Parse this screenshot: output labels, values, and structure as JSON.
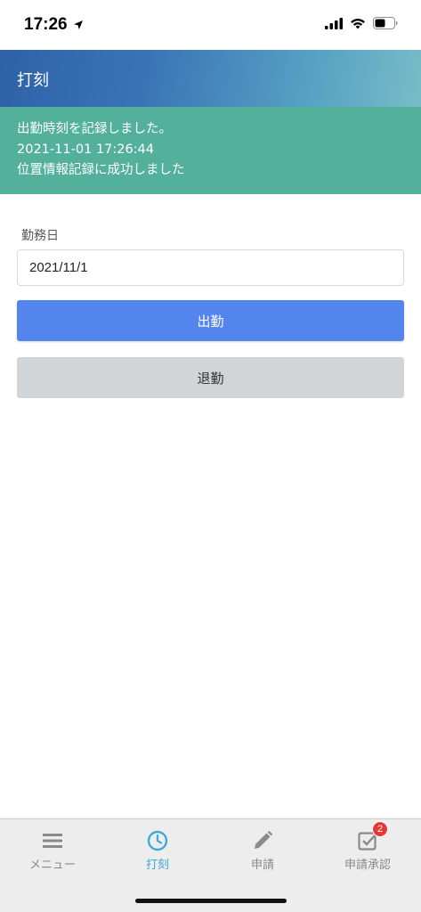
{
  "status_bar": {
    "time": "17:26"
  },
  "header": {
    "title": "打刻"
  },
  "notice": {
    "lines": [
      "出勤時刻を記録しました。",
      "2021-11-01 17:26:44",
      "位置情報記録に成功しました"
    ]
  },
  "form": {
    "work_date_label": "勤務日",
    "work_date_value": "2021/11/1",
    "clock_in_label": "出勤",
    "clock_out_label": "退勤"
  },
  "tab_bar": {
    "tabs": [
      {
        "label": "メニュー",
        "icon": "menu-icon",
        "active": false
      },
      {
        "label": "打刻",
        "icon": "clock-icon",
        "active": true
      },
      {
        "label": "申請",
        "icon": "pencil-icon",
        "active": false
      },
      {
        "label": "申請承認",
        "icon": "checkbox-icon",
        "active": false,
        "badge": "2"
      }
    ]
  },
  "colors": {
    "header_gradient_start": "#2f62a8",
    "header_gradient_end": "#78bcc6",
    "notice_bg": "#52b09b",
    "clock_in_button": "#5485ec",
    "clock_out_button": "#d1d5d8",
    "active_tab": "#3fa9d6",
    "badge": "#e53935"
  }
}
